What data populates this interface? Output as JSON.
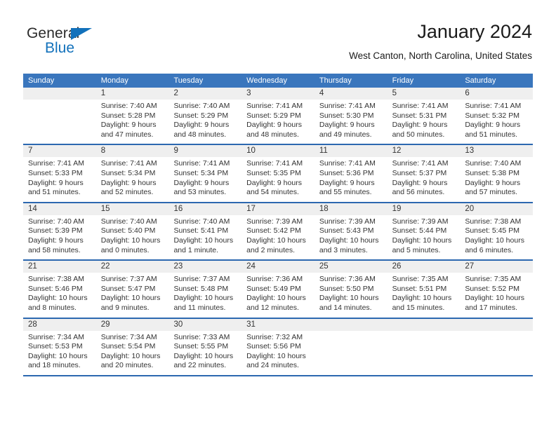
{
  "brand": {
    "name_part1": "General",
    "name_part2": "Blue",
    "accent_color": "#1271bb"
  },
  "header": {
    "title": "January 2024",
    "location": "West Canton, North Carolina, United States"
  },
  "theme": {
    "header_blue": "#3a76bd",
    "row_separator_blue": "#2c68b0",
    "day_band_gray": "#efefef"
  },
  "weekdays": [
    "Sunday",
    "Monday",
    "Tuesday",
    "Wednesday",
    "Thursday",
    "Friday",
    "Saturday"
  ],
  "weeks": [
    [
      {
        "day": "",
        "empty": true,
        "sunrise": "",
        "sunset": "",
        "daylight1": "",
        "daylight2": ""
      },
      {
        "day": "1",
        "sunrise": "Sunrise: 7:40 AM",
        "sunset": "Sunset: 5:28 PM",
        "daylight1": "Daylight: 9 hours",
        "daylight2": "and 47 minutes."
      },
      {
        "day": "2",
        "sunrise": "Sunrise: 7:40 AM",
        "sunset": "Sunset: 5:29 PM",
        "daylight1": "Daylight: 9 hours",
        "daylight2": "and 48 minutes."
      },
      {
        "day": "3",
        "sunrise": "Sunrise: 7:41 AM",
        "sunset": "Sunset: 5:29 PM",
        "daylight1": "Daylight: 9 hours",
        "daylight2": "and 48 minutes."
      },
      {
        "day": "4",
        "sunrise": "Sunrise: 7:41 AM",
        "sunset": "Sunset: 5:30 PM",
        "daylight1": "Daylight: 9 hours",
        "daylight2": "and 49 minutes."
      },
      {
        "day": "5",
        "sunrise": "Sunrise: 7:41 AM",
        "sunset": "Sunset: 5:31 PM",
        "daylight1": "Daylight: 9 hours",
        "daylight2": "and 50 minutes."
      },
      {
        "day": "6",
        "sunrise": "Sunrise: 7:41 AM",
        "sunset": "Sunset: 5:32 PM",
        "daylight1": "Daylight: 9 hours",
        "daylight2": "and 51 minutes."
      }
    ],
    [
      {
        "day": "7",
        "sunrise": "Sunrise: 7:41 AM",
        "sunset": "Sunset: 5:33 PM",
        "daylight1": "Daylight: 9 hours",
        "daylight2": "and 51 minutes."
      },
      {
        "day": "8",
        "sunrise": "Sunrise: 7:41 AM",
        "sunset": "Sunset: 5:34 PM",
        "daylight1": "Daylight: 9 hours",
        "daylight2": "and 52 minutes."
      },
      {
        "day": "9",
        "sunrise": "Sunrise: 7:41 AM",
        "sunset": "Sunset: 5:34 PM",
        "daylight1": "Daylight: 9 hours",
        "daylight2": "and 53 minutes."
      },
      {
        "day": "10",
        "sunrise": "Sunrise: 7:41 AM",
        "sunset": "Sunset: 5:35 PM",
        "daylight1": "Daylight: 9 hours",
        "daylight2": "and 54 minutes."
      },
      {
        "day": "11",
        "sunrise": "Sunrise: 7:41 AM",
        "sunset": "Sunset: 5:36 PM",
        "daylight1": "Daylight: 9 hours",
        "daylight2": "and 55 minutes."
      },
      {
        "day": "12",
        "sunrise": "Sunrise: 7:41 AM",
        "sunset": "Sunset: 5:37 PM",
        "daylight1": "Daylight: 9 hours",
        "daylight2": "and 56 minutes."
      },
      {
        "day": "13",
        "sunrise": "Sunrise: 7:40 AM",
        "sunset": "Sunset: 5:38 PM",
        "daylight1": "Daylight: 9 hours",
        "daylight2": "and 57 minutes."
      }
    ],
    [
      {
        "day": "14",
        "sunrise": "Sunrise: 7:40 AM",
        "sunset": "Sunset: 5:39 PM",
        "daylight1": "Daylight: 9 hours",
        "daylight2": "and 58 minutes."
      },
      {
        "day": "15",
        "sunrise": "Sunrise: 7:40 AM",
        "sunset": "Sunset: 5:40 PM",
        "daylight1": "Daylight: 10 hours",
        "daylight2": "and 0 minutes."
      },
      {
        "day": "16",
        "sunrise": "Sunrise: 7:40 AM",
        "sunset": "Sunset: 5:41 PM",
        "daylight1": "Daylight: 10 hours",
        "daylight2": "and 1 minute."
      },
      {
        "day": "17",
        "sunrise": "Sunrise: 7:39 AM",
        "sunset": "Sunset: 5:42 PM",
        "daylight1": "Daylight: 10 hours",
        "daylight2": "and 2 minutes."
      },
      {
        "day": "18",
        "sunrise": "Sunrise: 7:39 AM",
        "sunset": "Sunset: 5:43 PM",
        "daylight1": "Daylight: 10 hours",
        "daylight2": "and 3 minutes."
      },
      {
        "day": "19",
        "sunrise": "Sunrise: 7:39 AM",
        "sunset": "Sunset: 5:44 PM",
        "daylight1": "Daylight: 10 hours",
        "daylight2": "and 5 minutes."
      },
      {
        "day": "20",
        "sunrise": "Sunrise: 7:38 AM",
        "sunset": "Sunset: 5:45 PM",
        "daylight1": "Daylight: 10 hours",
        "daylight2": "and 6 minutes."
      }
    ],
    [
      {
        "day": "21",
        "sunrise": "Sunrise: 7:38 AM",
        "sunset": "Sunset: 5:46 PM",
        "daylight1": "Daylight: 10 hours",
        "daylight2": "and 8 minutes."
      },
      {
        "day": "22",
        "sunrise": "Sunrise: 7:37 AM",
        "sunset": "Sunset: 5:47 PM",
        "daylight1": "Daylight: 10 hours",
        "daylight2": "and 9 minutes."
      },
      {
        "day": "23",
        "sunrise": "Sunrise: 7:37 AM",
        "sunset": "Sunset: 5:48 PM",
        "daylight1": "Daylight: 10 hours",
        "daylight2": "and 11 minutes."
      },
      {
        "day": "24",
        "sunrise": "Sunrise: 7:36 AM",
        "sunset": "Sunset: 5:49 PM",
        "daylight1": "Daylight: 10 hours",
        "daylight2": "and 12 minutes."
      },
      {
        "day": "25",
        "sunrise": "Sunrise: 7:36 AM",
        "sunset": "Sunset: 5:50 PM",
        "daylight1": "Daylight: 10 hours",
        "daylight2": "and 14 minutes."
      },
      {
        "day": "26",
        "sunrise": "Sunrise: 7:35 AM",
        "sunset": "Sunset: 5:51 PM",
        "daylight1": "Daylight: 10 hours",
        "daylight2": "and 15 minutes."
      },
      {
        "day": "27",
        "sunrise": "Sunrise: 7:35 AM",
        "sunset": "Sunset: 5:52 PM",
        "daylight1": "Daylight: 10 hours",
        "daylight2": "and 17 minutes."
      }
    ],
    [
      {
        "day": "28",
        "sunrise": "Sunrise: 7:34 AM",
        "sunset": "Sunset: 5:53 PM",
        "daylight1": "Daylight: 10 hours",
        "daylight2": "and 18 minutes."
      },
      {
        "day": "29",
        "sunrise": "Sunrise: 7:34 AM",
        "sunset": "Sunset: 5:54 PM",
        "daylight1": "Daylight: 10 hours",
        "daylight2": "and 20 minutes."
      },
      {
        "day": "30",
        "sunrise": "Sunrise: 7:33 AM",
        "sunset": "Sunset: 5:55 PM",
        "daylight1": "Daylight: 10 hours",
        "daylight2": "and 22 minutes."
      },
      {
        "day": "31",
        "sunrise": "Sunrise: 7:32 AM",
        "sunset": "Sunset: 5:56 PM",
        "daylight1": "Daylight: 10 hours",
        "daylight2": "and 24 minutes."
      },
      {
        "day": "",
        "empty": true,
        "sunrise": "",
        "sunset": "",
        "daylight1": "",
        "daylight2": ""
      },
      {
        "day": "",
        "empty": true,
        "sunrise": "",
        "sunset": "",
        "daylight1": "",
        "daylight2": ""
      },
      {
        "day": "",
        "empty": true,
        "sunrise": "",
        "sunset": "",
        "daylight1": "",
        "daylight2": ""
      }
    ]
  ]
}
